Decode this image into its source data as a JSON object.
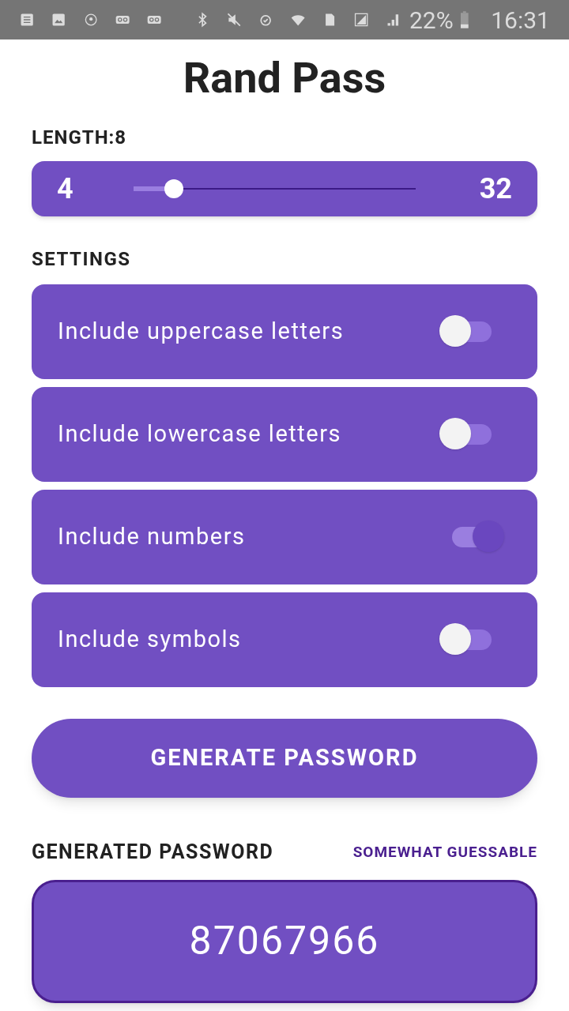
{
  "status_bar": {
    "battery": "22%",
    "time": "16:31"
  },
  "title": "Rand Pass",
  "length": {
    "label": "LENGTH:8",
    "min": "4",
    "max": "32",
    "level": 0.143
  },
  "settings": {
    "heading": "SETTINGS",
    "options": [
      {
        "label": "Include uppercase letters",
        "on": false
      },
      {
        "label": "Include lowercase letters",
        "on": false
      },
      {
        "label": "Include numbers",
        "on": true
      },
      {
        "label": "Include symbols",
        "on": false
      }
    ]
  },
  "generate_button": "GENERATE PASSWORD",
  "result": {
    "heading": "GENERATED PASSWORD",
    "strength": "SOMEWHAT GUESSABLE",
    "password": "87067966"
  }
}
